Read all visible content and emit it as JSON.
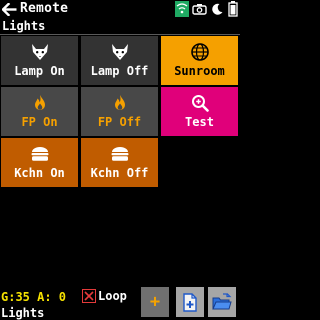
{
  "app": {
    "title": "Remote"
  },
  "section": {
    "name": "Lights"
  },
  "tiles": [
    {
      "label": "Lamp On",
      "icon": "fox-icon",
      "bg": "#333333",
      "fg": "#ffffff"
    },
    {
      "label": "Lamp Off",
      "icon": "fox-icon",
      "bg": "#333333",
      "fg": "#ffffff"
    },
    {
      "label": "Sunroom",
      "icon": "globe-icon",
      "bg": "#f5a000",
      "fg": "#000000"
    },
    {
      "label": "FP On",
      "icon": "flame-icon",
      "bg": "#484848",
      "fg": "#f5a000"
    },
    {
      "label": "FP Off",
      "icon": "flame-icon",
      "bg": "#484848",
      "fg": "#f5a000"
    },
    {
      "label": "Test",
      "icon": "search-icon",
      "bg": "#e0007a",
      "fg": "#ffffff"
    },
    {
      "label": "Kchn On",
      "icon": "burger-icon",
      "bg": "#c05c00",
      "fg": "#ffffff"
    },
    {
      "label": "Kchn Off",
      "icon": "burger-icon",
      "bg": "#c05c00",
      "fg": "#ffffff"
    }
  ],
  "footer": {
    "status": "G:35 A: 0",
    "loop_label": "Loop",
    "section": "Lights",
    "add_label": "+"
  },
  "colors": {
    "accent": "#f5a000",
    "status_text": "#f5e100",
    "wifi": "#1faa63",
    "checkbox": "#e43a3a"
  }
}
